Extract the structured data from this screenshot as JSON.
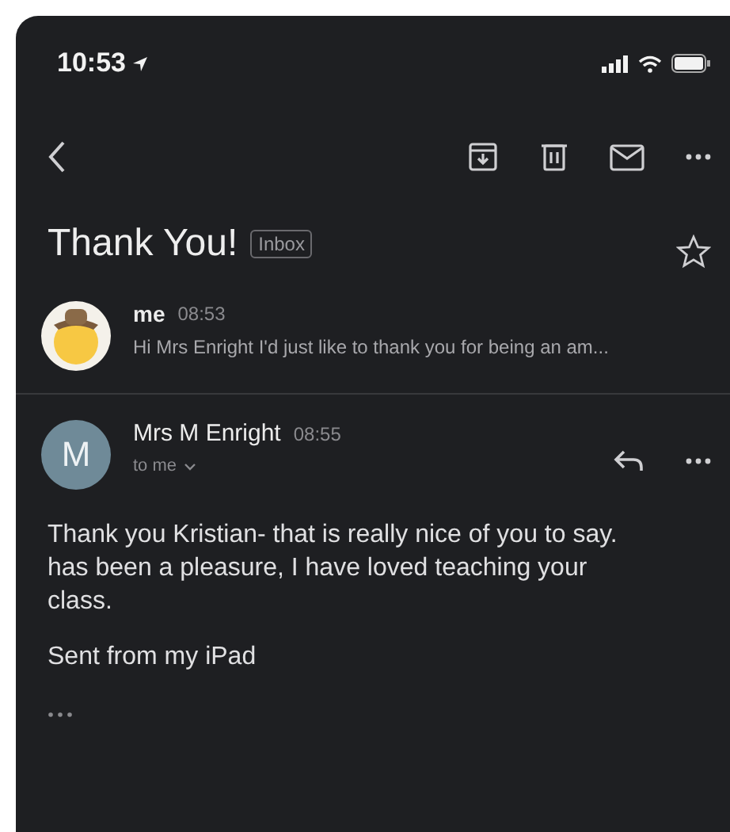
{
  "status_bar": {
    "time": "10:53"
  },
  "subject": {
    "title": "Thank You!",
    "label": "Inbox",
    "starred": false
  },
  "messages": [
    {
      "kind": "collapsed",
      "avatar": {
        "kind": "emoji"
      },
      "sender": "me",
      "time": "08:53",
      "snippet": "Hi Mrs Enright I'd just like to thank you for being an am..."
    },
    {
      "kind": "expanded",
      "avatar": {
        "kind": "letter",
        "initial": "M"
      },
      "sender": "Mrs M Enright",
      "time": "08:55",
      "recipient": "to me",
      "body_lines": [
        "Thank you Kristian- that is really nice of you to say.",
        "has been a pleasure, I have loved teaching your",
        "class."
      ],
      "signature": "Sent from my iPad"
    }
  ]
}
